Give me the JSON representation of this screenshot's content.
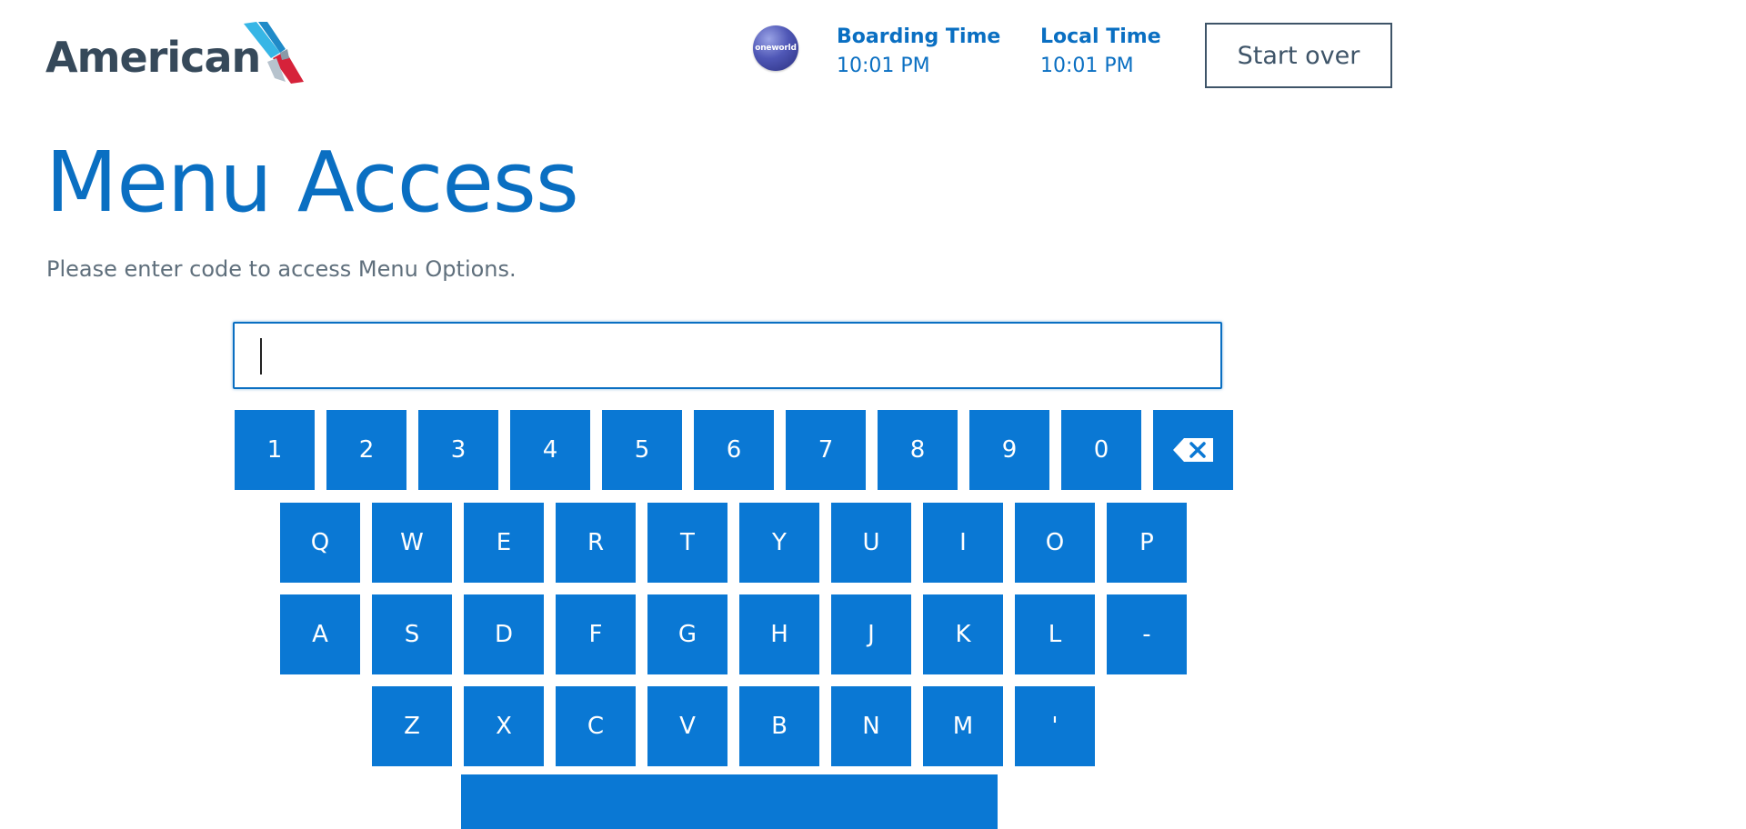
{
  "header": {
    "logo_text": "American",
    "badge_text": "oneworld",
    "boarding_label": "Boarding Time",
    "boarding_value": "10:01 PM",
    "local_label": "Local Time",
    "local_value": "10:01 PM",
    "start_over_label": "Start over"
  },
  "main": {
    "title": "Menu Access",
    "subtitle": "Please enter code to access Menu Options.",
    "code_value": ""
  },
  "keyboard": {
    "row1": [
      "1",
      "2",
      "3",
      "4",
      "5",
      "6",
      "7",
      "8",
      "9",
      "0"
    ],
    "backspace_icon": "backspace-icon",
    "row2": [
      "Q",
      "W",
      "E",
      "R",
      "T",
      "Y",
      "U",
      "I",
      "O",
      "P"
    ],
    "row3": [
      "A",
      "S",
      "D",
      "F",
      "G",
      "H",
      "J",
      "K",
      "L",
      "-"
    ],
    "row4": [
      "Z",
      "X",
      "C",
      "V",
      "B",
      "N",
      "M",
      "'"
    ]
  },
  "colors": {
    "accent": "#0a78d4",
    "title_blue": "#0a6fc2",
    "dark_slate": "#36495a"
  }
}
